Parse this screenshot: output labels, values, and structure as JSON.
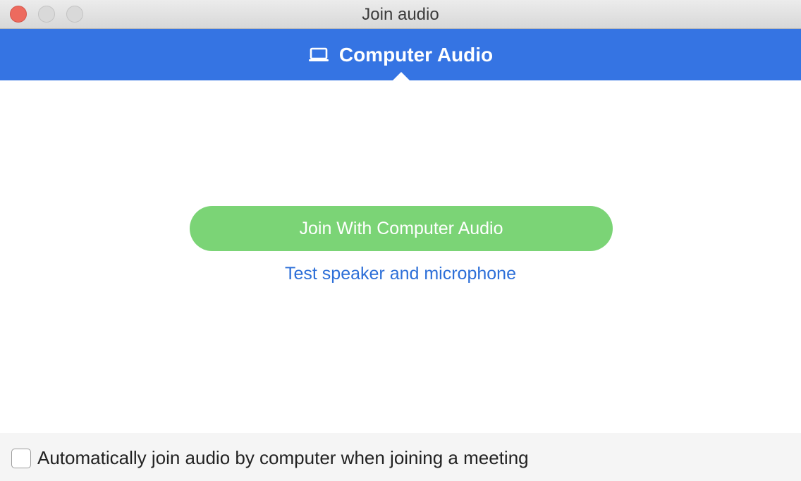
{
  "window": {
    "title": "Join audio"
  },
  "tabs": [
    {
      "label": "Computer Audio",
      "icon": "laptop-icon",
      "selected": true
    }
  ],
  "main": {
    "join_button_label": "Join With Computer Audio",
    "test_link_label": "Test speaker and microphone"
  },
  "footer": {
    "auto_join_label": "Automatically join audio by computer when joining a meeting",
    "auto_join_checked": false
  },
  "colors": {
    "tab_bar": "#3574e3",
    "join_button": "#7bd476",
    "link": "#2d6fd8",
    "close_button": "#ed6a5e"
  }
}
